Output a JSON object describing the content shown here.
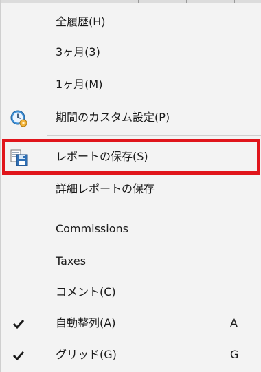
{
  "menu": {
    "items": [
      {
        "label": "全履歴(H)",
        "icon": null,
        "checked": false,
        "shortcut": ""
      },
      {
        "label": "3ヶ月(3)",
        "icon": null,
        "checked": false,
        "shortcut": ""
      },
      {
        "label": "1ヶ月(M)",
        "icon": null,
        "checked": false,
        "shortcut": ""
      },
      {
        "label": "期間のカスタム設定(P)",
        "icon": "clock-calendar-icon",
        "checked": false,
        "shortcut": ""
      },
      {
        "label": "レポートの保存(S)",
        "icon": "save-report-icon",
        "checked": false,
        "shortcut": "",
        "highlighted": true
      },
      {
        "label": "詳細レポートの保存",
        "icon": null,
        "checked": false,
        "shortcut": ""
      },
      {
        "label": "Commissions",
        "icon": null,
        "checked": false,
        "shortcut": ""
      },
      {
        "label": "Taxes",
        "icon": null,
        "checked": false,
        "shortcut": ""
      },
      {
        "label": "コメント(C)",
        "icon": null,
        "checked": false,
        "shortcut": ""
      },
      {
        "label": "自動整列(A)",
        "icon": "checkmark-icon",
        "checked": true,
        "shortcut": "A"
      },
      {
        "label": "グリッド(G)",
        "icon": "checkmark-icon",
        "checked": true,
        "shortcut": "G"
      }
    ]
  },
  "colors": {
    "menu_background": "#f3f3f3",
    "highlight_border": "#e0151b",
    "separator": "#cfcfcf",
    "text": "#1a1a1a"
  }
}
